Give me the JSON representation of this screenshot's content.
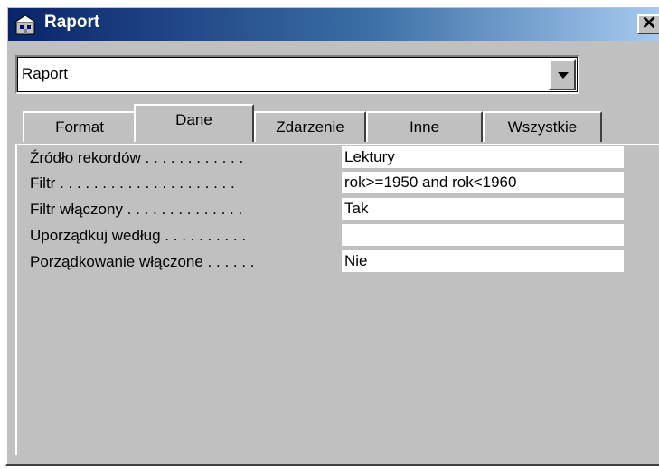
{
  "window": {
    "title": "Raport",
    "title_icon": "report-properties-icon",
    "close_icon": "close-icon",
    "close_glyph": "✕"
  },
  "selector": {
    "value": "Raport",
    "dropdown_icon": "chevron-down-icon"
  },
  "tabs": [
    {
      "label": "Format",
      "active": false
    },
    {
      "label": "Dane",
      "active": true
    },
    {
      "label": "Zdarzenie",
      "active": false
    },
    {
      "label": "Inne",
      "active": false
    },
    {
      "label": "Wszystkie",
      "active": false
    }
  ],
  "properties": [
    {
      "label": "Źródło rekordów . . . . . . . . . . . .",
      "value": "Lektury"
    },
    {
      "label": "Filtr . . . . . . . . . . . . . . . . . . . . .",
      "value": "rok>=1950 and rok<1960"
    },
    {
      "label": "Filtr włączony . . . . . . . . . . . . . .",
      "value": "Tak"
    },
    {
      "label": "Uporządkuj według . . . . . . . . . .",
      "value": ""
    },
    {
      "label": "Porządkowanie włączone . . . . . .",
      "value": "Nie"
    }
  ],
  "colors": {
    "titlebar_start": "#0a246a",
    "titlebar_end": "#a6caf0",
    "face": "#c0c0c0"
  }
}
